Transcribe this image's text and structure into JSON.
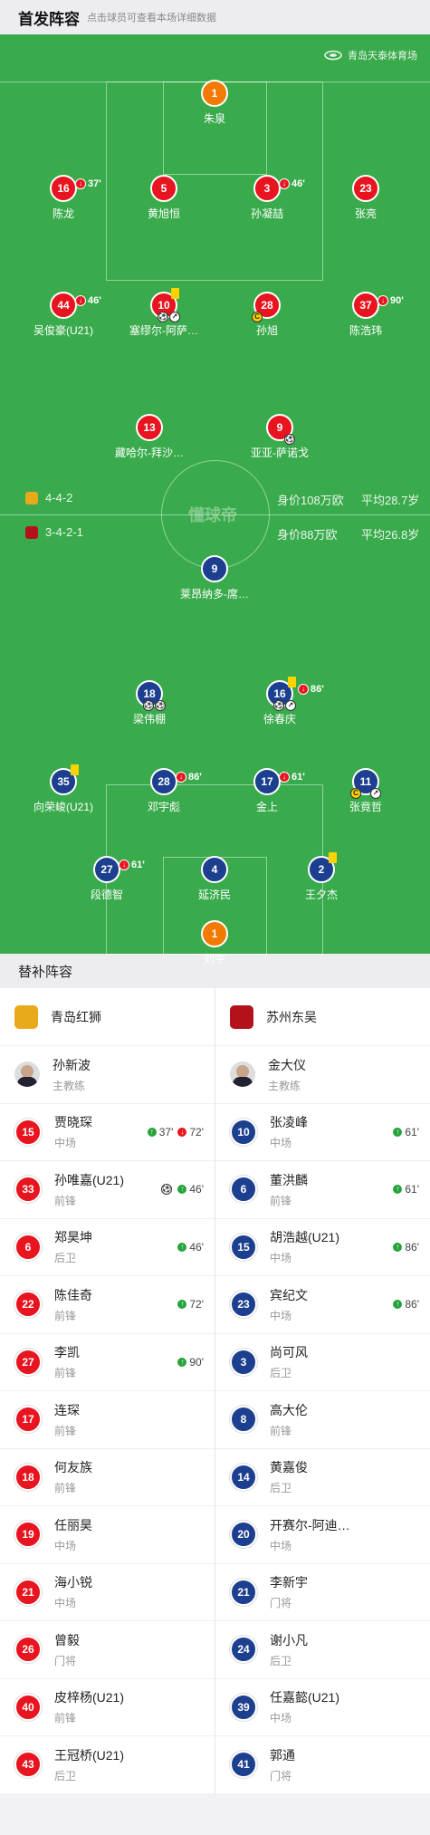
{
  "header": {
    "title": "首发阵容",
    "subtitle": "点击球员可查看本场详细数据"
  },
  "venue": "青岛天泰体育场",
  "watermark": "懂球帝",
  "home": {
    "formation": "4-4-2",
    "value": "身价108万欧",
    "age": "平均28.7岁",
    "color": "#e8141f"
  },
  "away": {
    "formation": "3-4-2-1",
    "value": "身价88万欧",
    "age": "平均26.8岁",
    "color": "#1d3f8f"
  },
  "pitch": {
    "home": [
      {
        "num": "1",
        "name": "朱泉",
        "gk": true
      },
      {
        "num": "16",
        "name": "陈龙",
        "ev": "37'"
      },
      {
        "num": "5",
        "name": "黄旭恒"
      },
      {
        "num": "3",
        "name": "孙凝喆",
        "ev": "46'"
      },
      {
        "num": "23",
        "name": "张亮"
      },
      {
        "num": "44",
        "name": "吴俊豪(U21)",
        "ev": "46'"
      },
      {
        "num": "10",
        "name": "塞缪尔-阿萨…"
      },
      {
        "num": "28",
        "name": "孙旭",
        "cap": "C"
      },
      {
        "num": "37",
        "name": "陈浩玮",
        "ev": "90'"
      },
      {
        "num": "13",
        "name": "藏哈尔-拜沙…"
      },
      {
        "num": "9",
        "name": "亚亚-萨诺戈"
      }
    ],
    "away": [
      {
        "num": "9",
        "name": "莱昂纳多-席…"
      },
      {
        "num": "18",
        "name": "梁伟棚"
      },
      {
        "num": "16",
        "name": "徐春庆",
        "ev": "86'"
      },
      {
        "num": "35",
        "name": "向荣峻(U21)"
      },
      {
        "num": "28",
        "name": "邓宇彪",
        "ev": "86'"
      },
      {
        "num": "17",
        "name": "金上",
        "ev": "61'"
      },
      {
        "num": "11",
        "name": "张竟哲",
        "cap": "C"
      },
      {
        "num": "27",
        "name": "段德智",
        "ev": "61'"
      },
      {
        "num": "4",
        "name": "延济民"
      },
      {
        "num": "2",
        "name": "王夕杰"
      },
      {
        "num": "1",
        "name": "刘宇",
        "gk": true
      }
    ]
  },
  "subs_title": "替补阵容",
  "subs": {
    "home_team": "青岛红狮",
    "away_team": "苏州东吴",
    "home_coach": {
      "name": "孙新波",
      "role": "主教练"
    },
    "away_coach": {
      "name": "金大仪",
      "role": "主教练"
    },
    "home": [
      {
        "num": "15",
        "name": "贾晓琛",
        "pos": "中场",
        "in": "37'",
        "out": "72'"
      },
      {
        "num": "33",
        "name": "孙唯嘉(U21)",
        "pos": "前锋",
        "in": "46'",
        "goal": true
      },
      {
        "num": "6",
        "name": "郑昊坤",
        "pos": "后卫",
        "in": "46'"
      },
      {
        "num": "22",
        "name": "陈佳奇",
        "pos": "前锋",
        "in": "72'"
      },
      {
        "num": "27",
        "name": "李凯",
        "pos": "前锋",
        "in": "90'"
      },
      {
        "num": "17",
        "name": "连琛",
        "pos": "前锋"
      },
      {
        "num": "18",
        "name": "何友族",
        "pos": "前锋"
      },
      {
        "num": "19",
        "name": "任丽昊",
        "pos": "中场"
      },
      {
        "num": "21",
        "name": "海小锐",
        "pos": "中场"
      },
      {
        "num": "26",
        "name": "曾毅",
        "pos": "门将"
      },
      {
        "num": "40",
        "name": "皮梓杨(U21)",
        "pos": "前锋"
      },
      {
        "num": "43",
        "name": "王冠桥(U21)",
        "pos": "后卫"
      }
    ],
    "away": [
      {
        "num": "10",
        "name": "张凌峰",
        "pos": "中场",
        "in": "61'"
      },
      {
        "num": "6",
        "name": "董洪麟",
        "pos": "前锋",
        "in": "61'"
      },
      {
        "num": "15",
        "name": "胡浩越(U21)",
        "pos": "中场",
        "in": "86'"
      },
      {
        "num": "23",
        "name": "宾纪文",
        "pos": "中场",
        "in": "86'"
      },
      {
        "num": "3",
        "name": "尚可风",
        "pos": "后卫"
      },
      {
        "num": "8",
        "name": "高大伦",
        "pos": "前锋"
      },
      {
        "num": "14",
        "name": "黄嘉俊",
        "pos": "后卫"
      },
      {
        "num": "20",
        "name": "开赛尔-阿迪…",
        "pos": "中场"
      },
      {
        "num": "21",
        "name": "李新宇",
        "pos": "门将"
      },
      {
        "num": "24",
        "name": "谢小凡",
        "pos": "后卫"
      },
      {
        "num": "39",
        "name": "任嘉懿(U21)",
        "pos": "中场"
      },
      {
        "num": "41",
        "name": "郭通",
        "pos": "门将"
      }
    ]
  }
}
